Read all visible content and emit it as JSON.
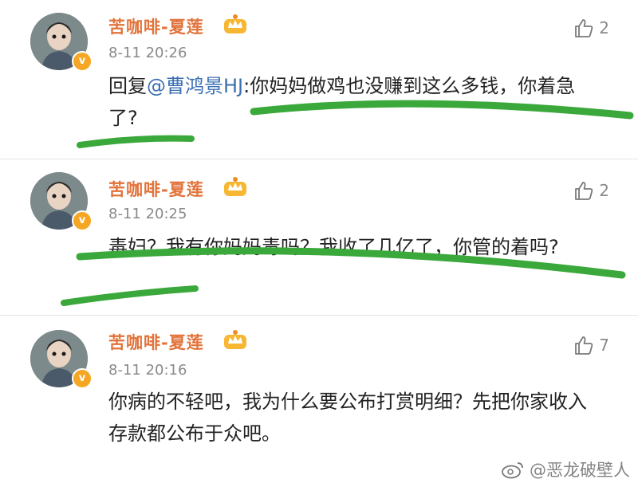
{
  "colors": {
    "username": "#e2733a",
    "mention": "#3b6fb3",
    "text": "#222222",
    "meta": "#8a8a8a",
    "highlight": "#3aa83a",
    "badge": "#f5a623"
  },
  "comments": [
    {
      "username": "苦咖啡-夏莲",
      "time": "8-11 20:26",
      "likes": "2",
      "reply_prefix": "回复",
      "mention": "@曹鸿景HJ",
      "text": ":你妈妈做鸡也没赚到这么多钱，你着急了?"
    },
    {
      "username": "苦咖啡-夏莲",
      "time": "8-11 20:25",
      "likes": "2",
      "text": "毒妇？我有你妈妈毒吗？我收了几亿了，你管的着吗?"
    },
    {
      "username": "苦咖啡-夏莲",
      "time": "8-11 20:16",
      "likes": "7",
      "text": "你病的不轻吧，我为什么要公布打赏明细？先把你家收入存款都公布于众吧。"
    }
  ],
  "watermark": {
    "text": "@恶龙破壁人",
    "icon": "weibo-logo-icon"
  }
}
